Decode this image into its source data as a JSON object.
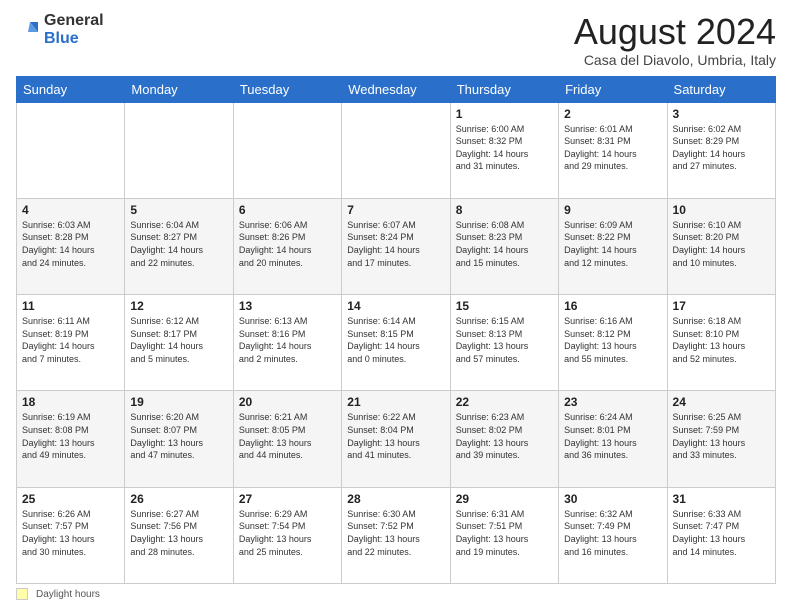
{
  "header": {
    "logo_general": "General",
    "logo_blue": "Blue",
    "month_title": "August 2024",
    "location": "Casa del Diavolo, Umbria, Italy"
  },
  "days_of_week": [
    "Sunday",
    "Monday",
    "Tuesday",
    "Wednesday",
    "Thursday",
    "Friday",
    "Saturday"
  ],
  "footer": {
    "daylight_label": "Daylight hours"
  },
  "weeks": [
    [
      {
        "day": "",
        "info": ""
      },
      {
        "day": "",
        "info": ""
      },
      {
        "day": "",
        "info": ""
      },
      {
        "day": "",
        "info": ""
      },
      {
        "day": "1",
        "info": "Sunrise: 6:00 AM\nSunset: 8:32 PM\nDaylight: 14 hours\nand 31 minutes."
      },
      {
        "day": "2",
        "info": "Sunrise: 6:01 AM\nSunset: 8:31 PM\nDaylight: 14 hours\nand 29 minutes."
      },
      {
        "day": "3",
        "info": "Sunrise: 6:02 AM\nSunset: 8:29 PM\nDaylight: 14 hours\nand 27 minutes."
      }
    ],
    [
      {
        "day": "4",
        "info": "Sunrise: 6:03 AM\nSunset: 8:28 PM\nDaylight: 14 hours\nand 24 minutes."
      },
      {
        "day": "5",
        "info": "Sunrise: 6:04 AM\nSunset: 8:27 PM\nDaylight: 14 hours\nand 22 minutes."
      },
      {
        "day": "6",
        "info": "Sunrise: 6:06 AM\nSunset: 8:26 PM\nDaylight: 14 hours\nand 20 minutes."
      },
      {
        "day": "7",
        "info": "Sunrise: 6:07 AM\nSunset: 8:24 PM\nDaylight: 14 hours\nand 17 minutes."
      },
      {
        "day": "8",
        "info": "Sunrise: 6:08 AM\nSunset: 8:23 PM\nDaylight: 14 hours\nand 15 minutes."
      },
      {
        "day": "9",
        "info": "Sunrise: 6:09 AM\nSunset: 8:22 PM\nDaylight: 14 hours\nand 12 minutes."
      },
      {
        "day": "10",
        "info": "Sunrise: 6:10 AM\nSunset: 8:20 PM\nDaylight: 14 hours\nand 10 minutes."
      }
    ],
    [
      {
        "day": "11",
        "info": "Sunrise: 6:11 AM\nSunset: 8:19 PM\nDaylight: 14 hours\nand 7 minutes."
      },
      {
        "day": "12",
        "info": "Sunrise: 6:12 AM\nSunset: 8:17 PM\nDaylight: 14 hours\nand 5 minutes."
      },
      {
        "day": "13",
        "info": "Sunrise: 6:13 AM\nSunset: 8:16 PM\nDaylight: 14 hours\nand 2 minutes."
      },
      {
        "day": "14",
        "info": "Sunrise: 6:14 AM\nSunset: 8:15 PM\nDaylight: 14 hours\nand 0 minutes."
      },
      {
        "day": "15",
        "info": "Sunrise: 6:15 AM\nSunset: 8:13 PM\nDaylight: 13 hours\nand 57 minutes."
      },
      {
        "day": "16",
        "info": "Sunrise: 6:16 AM\nSunset: 8:12 PM\nDaylight: 13 hours\nand 55 minutes."
      },
      {
        "day": "17",
        "info": "Sunrise: 6:18 AM\nSunset: 8:10 PM\nDaylight: 13 hours\nand 52 minutes."
      }
    ],
    [
      {
        "day": "18",
        "info": "Sunrise: 6:19 AM\nSunset: 8:08 PM\nDaylight: 13 hours\nand 49 minutes."
      },
      {
        "day": "19",
        "info": "Sunrise: 6:20 AM\nSunset: 8:07 PM\nDaylight: 13 hours\nand 47 minutes."
      },
      {
        "day": "20",
        "info": "Sunrise: 6:21 AM\nSunset: 8:05 PM\nDaylight: 13 hours\nand 44 minutes."
      },
      {
        "day": "21",
        "info": "Sunrise: 6:22 AM\nSunset: 8:04 PM\nDaylight: 13 hours\nand 41 minutes."
      },
      {
        "day": "22",
        "info": "Sunrise: 6:23 AM\nSunset: 8:02 PM\nDaylight: 13 hours\nand 39 minutes."
      },
      {
        "day": "23",
        "info": "Sunrise: 6:24 AM\nSunset: 8:01 PM\nDaylight: 13 hours\nand 36 minutes."
      },
      {
        "day": "24",
        "info": "Sunrise: 6:25 AM\nSunset: 7:59 PM\nDaylight: 13 hours\nand 33 minutes."
      }
    ],
    [
      {
        "day": "25",
        "info": "Sunrise: 6:26 AM\nSunset: 7:57 PM\nDaylight: 13 hours\nand 30 minutes."
      },
      {
        "day": "26",
        "info": "Sunrise: 6:27 AM\nSunset: 7:56 PM\nDaylight: 13 hours\nand 28 minutes."
      },
      {
        "day": "27",
        "info": "Sunrise: 6:29 AM\nSunset: 7:54 PM\nDaylight: 13 hours\nand 25 minutes."
      },
      {
        "day": "28",
        "info": "Sunrise: 6:30 AM\nSunset: 7:52 PM\nDaylight: 13 hours\nand 22 minutes."
      },
      {
        "day": "29",
        "info": "Sunrise: 6:31 AM\nSunset: 7:51 PM\nDaylight: 13 hours\nand 19 minutes."
      },
      {
        "day": "30",
        "info": "Sunrise: 6:32 AM\nSunset: 7:49 PM\nDaylight: 13 hours\nand 16 minutes."
      },
      {
        "day": "31",
        "info": "Sunrise: 6:33 AM\nSunset: 7:47 PM\nDaylight: 13 hours\nand 14 minutes."
      }
    ]
  ]
}
